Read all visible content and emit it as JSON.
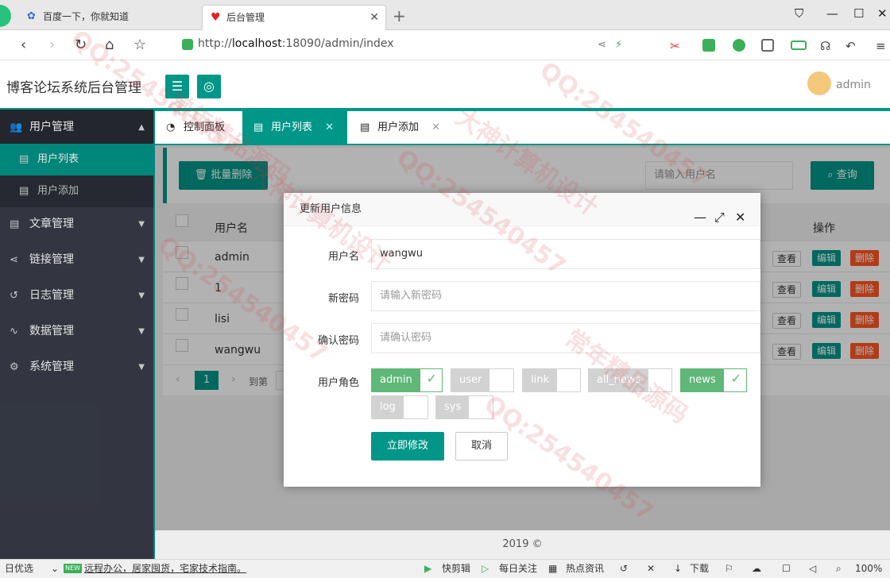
{
  "browser": {
    "tabs": [
      {
        "title": "百度一下，你就知道"
      },
      {
        "title": "后台管理"
      }
    ],
    "url_prefix": "http://",
    "url_host": "localhost",
    "url_rest": ":18090/admin/index"
  },
  "header": {
    "title": "博客论坛系统后台管理",
    "user": "admin"
  },
  "sidebar": {
    "items": [
      {
        "label": "用户管理"
      },
      {
        "label": "用户列表"
      },
      {
        "label": "用户添加"
      },
      {
        "label": "文章管理"
      },
      {
        "label": "链接管理"
      },
      {
        "label": "日志管理"
      },
      {
        "label": "数据管理"
      },
      {
        "label": "系统管理"
      }
    ]
  },
  "tabs": [
    {
      "label": "控制面板"
    },
    {
      "label": "用户列表"
    },
    {
      "label": "用户添加"
    }
  ],
  "toolbar": {
    "batch_delete": "批量删除",
    "search_placeholder": "请输入用户名",
    "search_button": "查询"
  },
  "table": {
    "headers": [
      "用户名",
      "操作"
    ],
    "rows": [
      {
        "username": "admin"
      },
      {
        "username": "1"
      },
      {
        "username": "lisi"
      },
      {
        "username": "wangwu"
      }
    ],
    "actions": {
      "view": "查看",
      "edit": "编辑",
      "delete": "删除"
    }
  },
  "pager": {
    "current": "1",
    "goto": "到第"
  },
  "footer": "2019 ©",
  "dialog": {
    "title": "更新用户信息",
    "username_label": "用户名",
    "username_value": "wangwu",
    "new_password_label": "新密码",
    "new_password_placeholder": "请输入新密码",
    "confirm_password_label": "确认密码",
    "confirm_password_placeholder": "请确认密码",
    "role_label": "用户角色",
    "roles": [
      {
        "name": "admin",
        "checked": true
      },
      {
        "name": "user",
        "checked": false
      },
      {
        "name": "link",
        "checked": false
      },
      {
        "name": "all_news",
        "checked": false
      },
      {
        "name": "news",
        "checked": true
      },
      {
        "name": "log",
        "checked": false
      },
      {
        "name": "sys",
        "checked": false
      }
    ],
    "submit": "立即修改",
    "cancel": "取消"
  },
  "statusbar": {
    "left": "日优选",
    "badge": "NEW",
    "news": "远程办公，居家囤货，宅家技术指南。",
    "items": [
      "快剪辑",
      "每日关注",
      "热点资讯",
      "下载"
    ],
    "zoom": "100%"
  },
  "watermark": [
    "QQ:254540457",
    "大神计算机设计",
    "常年精品源码"
  ],
  "colors": {
    "accent": "#009688",
    "danger": "#ff5722",
    "sidebar": "#393d49",
    "role_on": "#5fb878"
  }
}
